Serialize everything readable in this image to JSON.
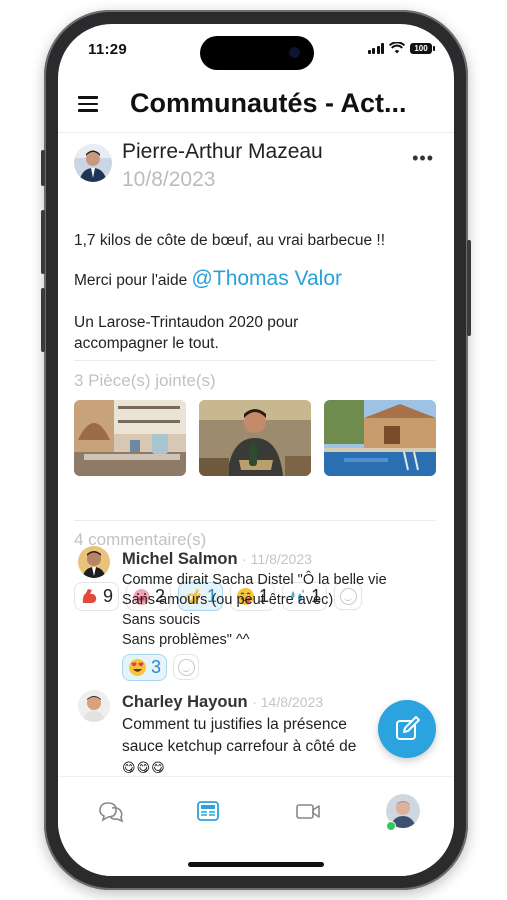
{
  "status_bar": {
    "time": "11:29",
    "battery": "100"
  },
  "header": {
    "title": "Communautés - Act...",
    "menu_icon": "hamburger-menu-icon"
  },
  "post": {
    "author": "Pierre-Arthur Mazeau",
    "date": "10/8/2023",
    "more_label": "•••",
    "line1": "1,7 kilos de côte de bœuf,  au vrai barbecue !!",
    "line2_prefix": "Merci pour l'aide",
    "mention": "@Thomas Valor",
    "line3": "Un Larose-Trintaudon 2020 pour",
    "line4": "accompagner le tout.",
    "attachments_label": "3 Pièce(s) jointe(s)",
    "attachments": [
      "kitchen-photo",
      "grill-man-photo",
      "pool-barbecue-photo"
    ],
    "reactions": [
      {
        "icon": "flexed-biceps-emoji",
        "count": "9",
        "active": false
      },
      {
        "icon": "pig-face-emoji",
        "count": "2",
        "active": false
      },
      {
        "icon": "ok-hand-emoji",
        "count": "1",
        "active": true
      },
      {
        "icon": "yum-face-emoji",
        "count": "1",
        "active": false
      },
      {
        "icon": "sweat-drops-emoji",
        "count": "1",
        "active": false
      }
    ],
    "comments_label": "4 commentaire(s)"
  },
  "comments": [
    {
      "author": "Michel Salmon",
      "date": "· 11/8/2023",
      "lines": [
        "Comme dirait Sacha Distel \"Ô la belle vie",
        "Sans amours (ou peut être avec)",
        "Sans soucis",
        "Sans problèmes\" ^^"
      ],
      "reaction": {
        "icon": "heart-eyes-emoji",
        "count": "3"
      }
    },
    {
      "author": "Charley Hayoun",
      "date": "· 14/8/2023",
      "lines": [
        "Comment tu justifies la présence",
        "sauce ketchup carrefour à côté de"
      ],
      "emojis": "😋😋😋"
    }
  ],
  "tabbar": {
    "tabs": [
      "chat-bubbles-icon",
      "news-feed-icon",
      "video-camera-icon",
      "profile-avatar"
    ],
    "active": 1
  },
  "colors": {
    "accent": "#2aa3de",
    "mention": "#2aa0d8",
    "muted": "#c2c2c2",
    "online": "#34c759"
  }
}
